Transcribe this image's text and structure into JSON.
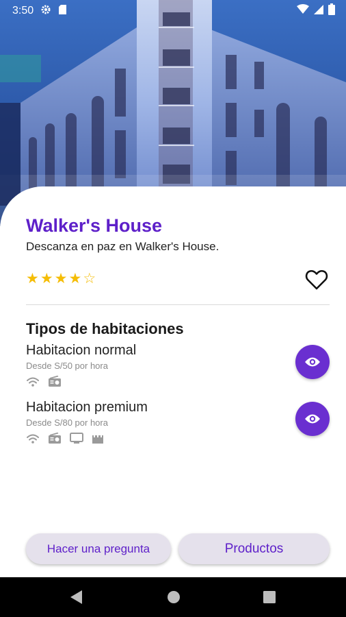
{
  "status_bar": {
    "time": "3:50",
    "icons": [
      "settings-gear-icon",
      "sd-card-icon",
      "wifi-icon",
      "cell-signal-icon",
      "battery-icon"
    ]
  },
  "hotel": {
    "name": "Walker's House",
    "tagline": "Descanza en paz en Walker's House.",
    "rating": 4,
    "rating_max": 5,
    "favorite_icon": "heart-outline-icon"
  },
  "rooms_section": {
    "title": "Tipos de habitaciones",
    "rooms": [
      {
        "name": "Habitacion normal",
        "price": "Desde S/50 por hora",
        "amenities": [
          "wifi-icon",
          "radio-icon"
        ],
        "action_icon": "eye-icon"
      },
      {
        "name": "Habitacion premium",
        "price": "Desde S/80 por hora",
        "amenities": [
          "wifi-icon",
          "radio-icon",
          "tv-icon",
          "movie-clapper-icon"
        ],
        "action_icon": "eye-icon"
      }
    ]
  },
  "actions": {
    "question_label": "Hacer una pregunta",
    "products_label": "Productos"
  },
  "nav_bar": {
    "icons": [
      "back-icon",
      "home-icon",
      "recents-icon"
    ]
  },
  "colors": {
    "accent": "#5e20c9",
    "fab": "#6a2fd0",
    "star": "#f5bd06",
    "button_bg": "#e5e1ec"
  }
}
